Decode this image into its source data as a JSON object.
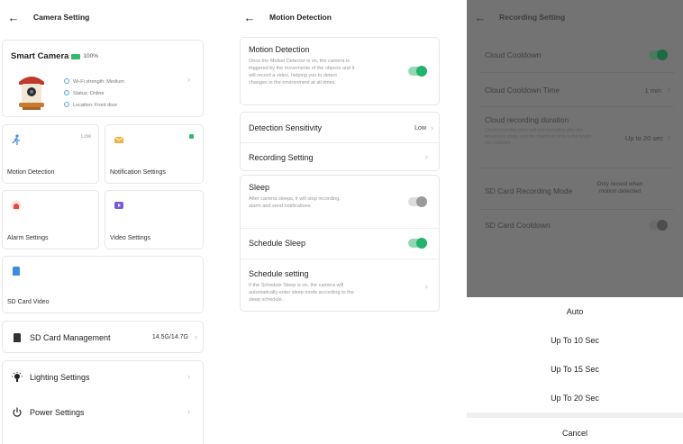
{
  "panel1": {
    "title": "Camera Setting",
    "camera_name": "Smart Camera",
    "battery": "100%",
    "wifi": "Wi-Fi strength: Medium",
    "status": "Status: Online",
    "location": "Location: Front door",
    "tiles": [
      {
        "label": "Motion Detection",
        "side": "Low"
      },
      {
        "label": "Notification Settings"
      },
      {
        "label": "Alarm Settings"
      },
      {
        "label": "Video Settings"
      },
      {
        "label": "SD Card Video"
      }
    ],
    "sd_management": {
      "label": "SD Card Management",
      "value": "14.5G/14.7G"
    },
    "lighting": "Lighting Settings",
    "power": "Power Settings"
  },
  "panel2": {
    "title": "Motion Detection",
    "motion": {
      "label": "Motion Detection",
      "desc": "Once the Motion Detector is on, the camera is triggered by the movements of the objects and it will record a video, helping you to detect changes in the environment at all times."
    },
    "sensitivity": {
      "label": "Detection Sensitivity",
      "value": "Low"
    },
    "recording": "Recording Setting",
    "sleep": {
      "label": "Sleep",
      "desc": "After camera sleeps, it will stop recording, alarm and send notifications"
    },
    "schedule_sleep": "Schedule Sleep",
    "schedule_setting": {
      "label": "Schedule setting",
      "desc": "If the Schedule Sleep is on, the camera will automatically enter sleep mode according to the sleep schedule."
    }
  },
  "panel3": {
    "title": "Recording Setting",
    "cloud_cooldown": "Cloud Cooldown",
    "cloud_cooldown_time": {
      "label": "Cloud Cooldown Time",
      "value": "1 min"
    },
    "cloud_duration": {
      "label": "Cloud recording duration",
      "desc": "Cloud recording video will end recording after the movement stops, and the maximum time is the length you selected",
      "value": "Up to 20 sec"
    },
    "sd_mode": {
      "label": "SD Card Recording Mode",
      "value": "Only record when motion detected"
    },
    "sd_cooldown": "SD Card Cooldown",
    "options": [
      "Auto",
      "Up To 10 Sec",
      "Up To 15 Sec",
      "Up To 20 Sec"
    ],
    "cancel": "Cancel"
  },
  "colors": {
    "accent_green": "#22b46b",
    "overlay": "#737373"
  }
}
